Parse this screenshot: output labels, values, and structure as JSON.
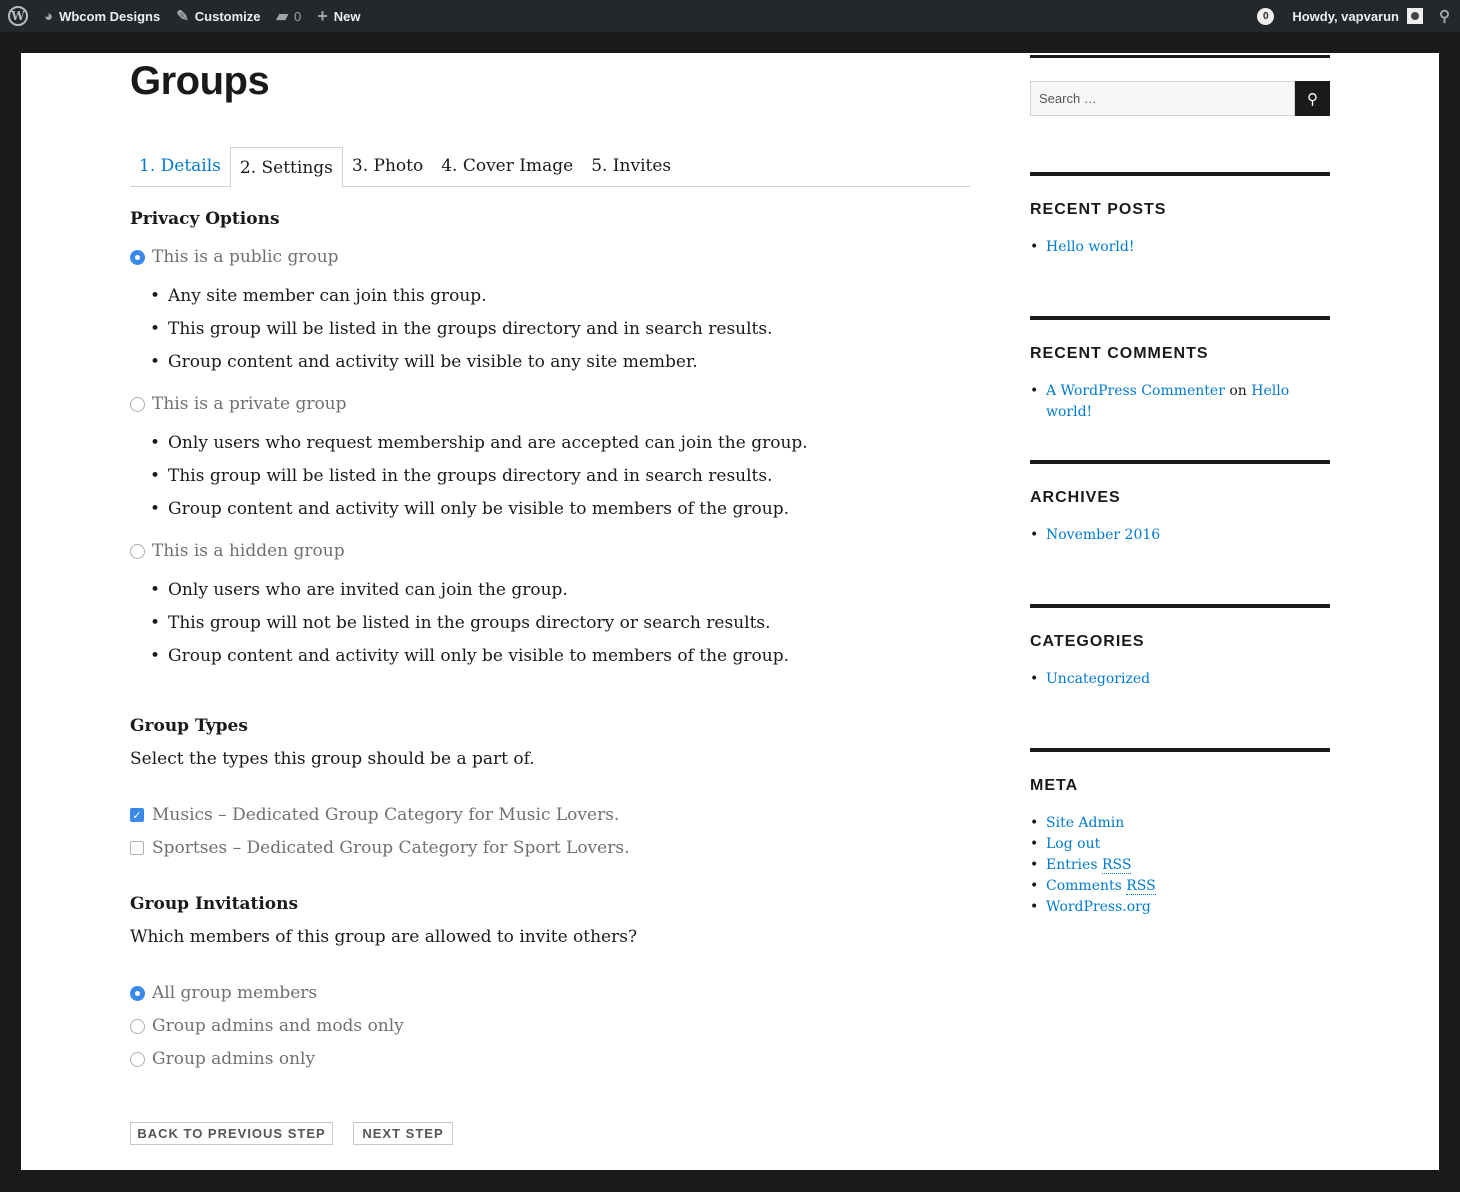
{
  "admin_bar": {
    "site_name": "Wbcom Designs",
    "customize": "Customize",
    "comments_count": "0",
    "new": "New",
    "notifications": "0",
    "howdy": "Howdy, vapvarun"
  },
  "main": {
    "title": "Groups",
    "tabs": [
      "1. Details",
      "2. Settings",
      "3. Photo",
      "4. Cover Image",
      "5. Invites"
    ],
    "privacy_heading": "Privacy Options",
    "privacy_options": [
      {
        "label": "This is a public group",
        "checked": true,
        "bullets": [
          "Any site member can join this group.",
          "This group will be listed in the groups directory and in search results.",
          "Group content and activity will be visible to any site member."
        ]
      },
      {
        "label": "This is a private group",
        "checked": false,
        "bullets": [
          "Only users who request membership and are accepted can join the group.",
          "This group will be listed in the groups directory and in search results.",
          "Group content and activity will only be visible to members of the group."
        ]
      },
      {
        "label": "This is a hidden group",
        "checked": false,
        "bullets": [
          "Only users who are invited can join the group.",
          "This group will not be listed in the groups directory or search results.",
          "Group content and activity will only be visible to members of the group."
        ]
      }
    ],
    "types_heading": "Group Types",
    "types_intro": "Select the types this group should be a part of.",
    "types": [
      {
        "label": "Musics – Dedicated Group Category for Music Lovers.",
        "checked": true
      },
      {
        "label": "Sportses – Dedicated Group Category for Sport Lovers.",
        "checked": false
      }
    ],
    "invites_heading": "Group Invitations",
    "invites_intro": "Which members of this group are allowed to invite others?",
    "invite_options": [
      {
        "label": "All group members",
        "checked": true
      },
      {
        "label": "Group admins and mods only",
        "checked": false
      },
      {
        "label": "Group admins only",
        "checked": false
      }
    ],
    "back_button": "BACK TO PREVIOUS STEP",
    "next_button": "NEXT STEP"
  },
  "sidebar": {
    "search_placeholder": "Search …",
    "recent_posts_title": "RECENT POSTS",
    "recent_posts": [
      "Hello world!"
    ],
    "recent_comments_title": "RECENT COMMENTS",
    "recent_comment": {
      "author": "A WordPress Commenter",
      "on": "on",
      "post": "Hello world!"
    },
    "archives_title": "ARCHIVES",
    "archives": [
      "November 2016"
    ],
    "categories_title": "CATEGORIES",
    "categories": [
      "Uncategorized"
    ],
    "meta_title": "META",
    "meta": {
      "site_admin": "Site Admin",
      "log_out": "Log out",
      "entries": "Entries",
      "comments": "Comments",
      "rss": "RSS",
      "wordpress_org": "WordPress.org"
    }
  },
  "colors": {
    "accent": "#3a8be8",
    "link": "#007acc",
    "adminbar": "#23282d"
  }
}
